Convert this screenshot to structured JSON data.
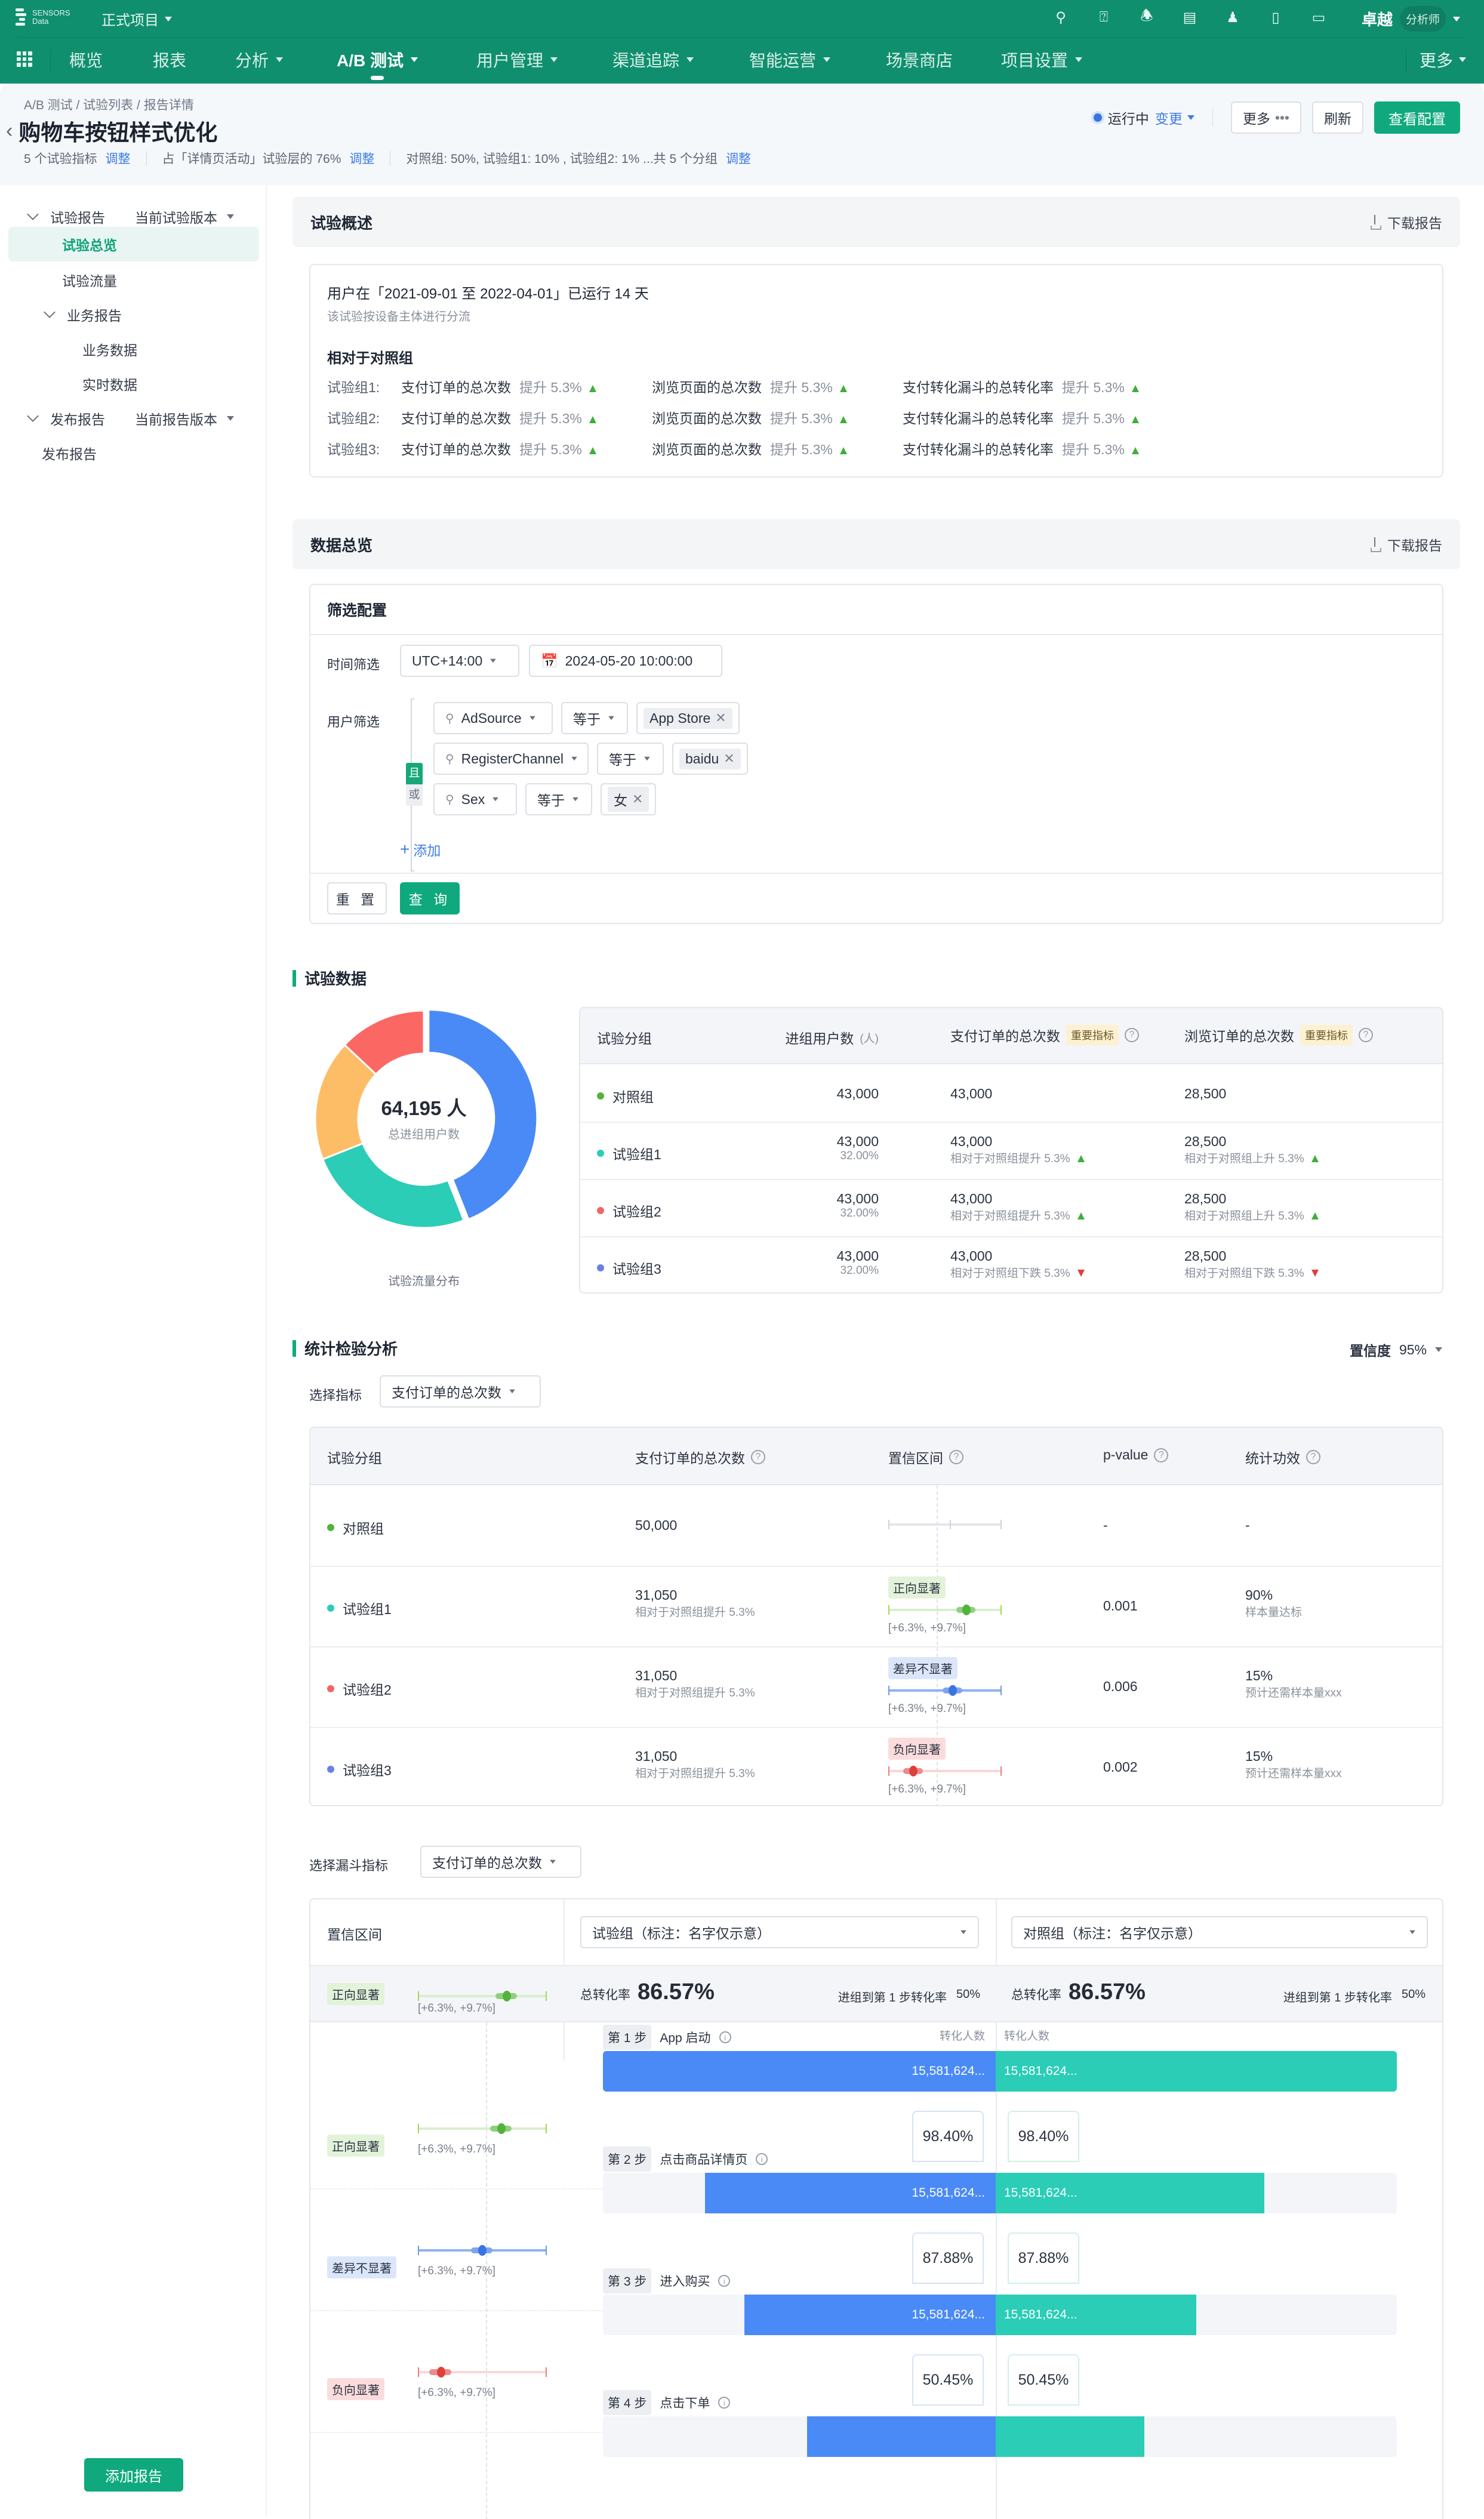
{
  "topbar": {
    "logo_line1": "SENSORS",
    "logo_line2": "Data",
    "project": "正式项目",
    "icons": [
      "search-icon",
      "help-icon",
      "bell-icon",
      "inbox-icon",
      "user-icon",
      "mobile-icon",
      "monitor-icon"
    ],
    "user_name": "卓越",
    "user_role": "分析师"
  },
  "nav": {
    "items": [
      {
        "label": "概览",
        "has_menu": false
      },
      {
        "label": "报表",
        "has_menu": false
      },
      {
        "label": "分析",
        "has_menu": true
      },
      {
        "label": "A/B 测试",
        "has_menu": true,
        "active": true
      },
      {
        "label": "用户管理",
        "has_menu": true
      },
      {
        "label": "渠道追踪",
        "has_menu": true
      },
      {
        "label": "智能运营",
        "has_menu": true
      },
      {
        "label": "场景商店",
        "has_menu": false
      },
      {
        "label": "项目设置",
        "has_menu": true
      }
    ],
    "more": "更多"
  },
  "header": {
    "breadcrumb": "A/B 测试 / 试验列表 / 报告详情",
    "title": "购物车按钮样式优化",
    "meta": {
      "metrics": "5 个试验指标",
      "adjust": "调整",
      "layer": "占「详情页活动」试验层的 76%",
      "groups": "对照组: 50%,  试验组1: 10% ,  试验组2: 1% ...共 5 个分组"
    },
    "status": "运行中",
    "change": "变更",
    "more_btn": "更多",
    "refresh_btn": "刷新",
    "config_btn": "查看配置"
  },
  "sidebar": {
    "report_group": "试验报告",
    "report_version": "当前试验版本",
    "items": [
      "试验总览",
      "试验流量"
    ],
    "business": "业务报告",
    "business_items": [
      "业务数据",
      "实时数据"
    ],
    "publish_group": "发布报告",
    "publish_version": "当前报告版本",
    "publish_item": "发布报告",
    "add_report": "添加报告"
  },
  "overview": {
    "title": "试验概述",
    "download": "下载报告",
    "run_line": "用户在「2021-09-01 至 2022-04-01」已运行 14 天",
    "split_note": "该试验按设备主体进行分流",
    "relative_heading": "相对于对照组",
    "rows": [
      {
        "group": "试验组1:",
        "items": [
          {
            "metric": "支付订单的总次数",
            "change": "提升 5.3%"
          },
          {
            "metric": "浏览页面的总次数",
            "change": "提升 5.3%"
          },
          {
            "metric": "支付转化漏斗的总转化率",
            "change": "提升 5.3%"
          }
        ]
      },
      {
        "group": "试验组2:",
        "items": [
          {
            "metric": "支付订单的总次数",
            "change": "提升 5.3%"
          },
          {
            "metric": "浏览页面的总次数",
            "change": "提升 5.3%"
          },
          {
            "metric": "支付转化漏斗的总转化率",
            "change": "提升 5.3%"
          }
        ]
      },
      {
        "group": "试验组3:",
        "items": [
          {
            "metric": "支付订单的总次数",
            "change": "提升 5.3%"
          },
          {
            "metric": "浏览页面的总次数",
            "change": "提升 5.3%"
          },
          {
            "metric": "支付转化漏斗的总转化率",
            "change": "提升 5.3%"
          }
        ]
      }
    ]
  },
  "data_overview": {
    "title": "数据总览",
    "download": "下载报告",
    "filter": {
      "title": "筛选配置",
      "time_label": "时间筛选",
      "timezone": "UTC+14:00",
      "datetime": "2024-05-20 10:00:00",
      "user_label": "用户筛选",
      "and_label": "且",
      "or_label": "或",
      "conditions": [
        {
          "property": "AdSource",
          "operator": "等于",
          "value": "App Store"
        },
        {
          "property": "RegisterChannel",
          "operator": "等于",
          "value": "baidu"
        },
        {
          "property": "Sex",
          "operator": "等于",
          "value": "女"
        }
      ],
      "add": "添加",
      "reset": "重 置",
      "query": "查 询"
    }
  },
  "experiment_data": {
    "title": "试验数据",
    "total": "64,195 人",
    "total_label": "总进组用户数",
    "chart_caption": "试验流量分布",
    "headers": {
      "group": "试验分组",
      "users": "进组用户数",
      "users_unit": "(人)",
      "metric1": "支付订单的总次数",
      "metric2": "浏览订单的总次数",
      "important": "重要指标"
    },
    "rows": [
      {
        "group": "对照组",
        "color": "#52b33c",
        "users": "43,000",
        "share": "",
        "m1": "43,000",
        "m1_note": "",
        "m1_dir": "",
        "m2": "28,500",
        "m2_note": "",
        "m2_dir": ""
      },
      {
        "group": "试验组1",
        "color": "#2bcdb6",
        "users": "43,000",
        "share": "32.00%",
        "m1": "43,000",
        "m1_note": "相对于对照组提升 5.3%",
        "m1_dir": "up",
        "m2": "28,500",
        "m2_note": "相对于对照组上升 5.3%",
        "m2_dir": "up"
      },
      {
        "group": "试验组2",
        "color": "#f56565",
        "users": "43,000",
        "share": "32.00%",
        "m1": "43,000",
        "m1_note": "相对于对照组提升 5.3%",
        "m1_dir": "up",
        "m2": "28,500",
        "m2_note": "相对于对照组上升 5.3%",
        "m2_dir": "up"
      },
      {
        "group": "试验组3",
        "color": "#6b7fe8",
        "users": "43,000",
        "share": "32.00%",
        "m1": "43,000",
        "m1_note": "相对于对照组下跌 5.3%",
        "m1_dir": "down",
        "m2": "28,500",
        "m2_note": "相对于对照组下跌 5.3%",
        "m2_dir": "down"
      }
    ]
  },
  "chart_data": {
    "type": "pie",
    "title": "试验流量分布",
    "center_value": "64,195 人",
    "center_label": "总进组用户数",
    "slices": [
      {
        "label": "slice-blue",
        "value": 44,
        "color": "#4a8af7"
      },
      {
        "label": "slice-teal",
        "value": 25,
        "color": "#2bcdb6"
      },
      {
        "label": "slice-orange",
        "value": 18,
        "color": "#fdbd67"
      },
      {
        "label": "slice-red",
        "value": 13,
        "color": "#fb6864"
      }
    ]
  },
  "stat_analysis": {
    "title": "统计检验分析",
    "confidence_label": "置信度",
    "confidence": "95%",
    "metric_label": "选择指标",
    "metric": "支付订单的总次数",
    "headers": {
      "group": "试验分组",
      "metric": "支付订单的总次数",
      "ci": "置信区间",
      "p": "p-value",
      "power": "统计功效"
    },
    "rows": [
      {
        "group": "对照组",
        "color": "#52b33c",
        "value": "50,000",
        "note": "",
        "sig": "",
        "sig_type": "none",
        "ci": "",
        "p": "-",
        "power": "-",
        "power_note": "",
        "point": 0.55,
        "lo": 0.0,
        "hi": 0.0
      },
      {
        "group": "试验组1",
        "color": "#2bcdb6",
        "value": "31,050",
        "note": "相对于对照组提升 5.3%",
        "sig": "正向显著",
        "sig_type": "pos",
        "ci": "[+6.3%, +9.7%]",
        "p": "0.001",
        "power": "90%",
        "power_note": "样本量达标",
        "point": 0.69,
        "lo": 0.55,
        "hi": 0.83
      },
      {
        "group": "试验组2",
        "color": "#f56565",
        "value": "31,050",
        "note": "相对于对照组提升 5.3%",
        "sig": "差异不显著",
        "sig_type": "neutral",
        "ci": "[+6.3%, +9.7%]",
        "p": "0.006",
        "power": "15%",
        "power_note": "预计还需样本量xxx",
        "point": 0.57,
        "lo": 0.43,
        "hi": 0.72
      },
      {
        "group": "试验组3",
        "color": "#6b7fe8",
        "value": "31,050",
        "note": "相对于对照组提升 5.3%",
        "sig": "负向显著",
        "sig_type": "neg",
        "ci": "[+6.3%, +9.7%]",
        "p": "0.002",
        "power": "15%",
        "power_note": "预计还需样本量xxx",
        "point": 0.22,
        "lo": 0.08,
        "hi": 0.37
      }
    ]
  },
  "funnel": {
    "metric_label": "选择漏斗指标",
    "metric": "支付订单的总次数",
    "ci_header": "置信区间",
    "left_select": "试验组（标注：名字仅示意）",
    "right_select": "对照组（标注：名字仅示意）",
    "total_rate_label": "总转化率",
    "total_rate_left": "86.57%",
    "total_rate_right": "86.57%",
    "step1_rate_label": "进组到第 1 步转化率",
    "step1_rate_left": "50%",
    "step1_rate_right": "50%",
    "summary_sig": "正向显著",
    "summary_ci": "[+6.3%, +9.7%]",
    "converted_label": "转化人数",
    "steps": [
      {
        "num": "第 1 步",
        "name": "App 启动",
        "left": "15,581,624...",
        "right": "15,581,624...",
        "left_frac": 1.0,
        "right_frac": 1.0
      },
      {
        "num": "第 2 步",
        "name": "点击商品详情页",
        "left": "15,581,624...",
        "right": "15,581,624...",
        "left_frac": 0.74,
        "right_frac": 0.67
      },
      {
        "num": "第 3 步",
        "name": "进入购买",
        "left": "15,581,624...",
        "right": "15,581,624...",
        "left_frac": 0.64,
        "right_frac": 0.5
      },
      {
        "num": "第 4 步",
        "name": "点击下单",
        "left": "",
        "right": "",
        "left_frac": 0.48,
        "right_frac": 0.37
      }
    ],
    "rates": [
      {
        "left": "98.40%",
        "right": "98.40%",
        "sig": "正向显著",
        "sig_type": "pos",
        "ci": "[+6.3%, +9.7%]"
      },
      {
        "left": "87.88%",
        "right": "87.88%",
        "sig": "差异不显著",
        "sig_type": "neutral",
        "ci": "[+6.3%, +9.7%]"
      },
      {
        "left": "50.45%",
        "right": "50.45%",
        "sig": "负向显著",
        "sig_type": "neg",
        "ci": "[+6.3%, +9.7%]"
      }
    ]
  }
}
